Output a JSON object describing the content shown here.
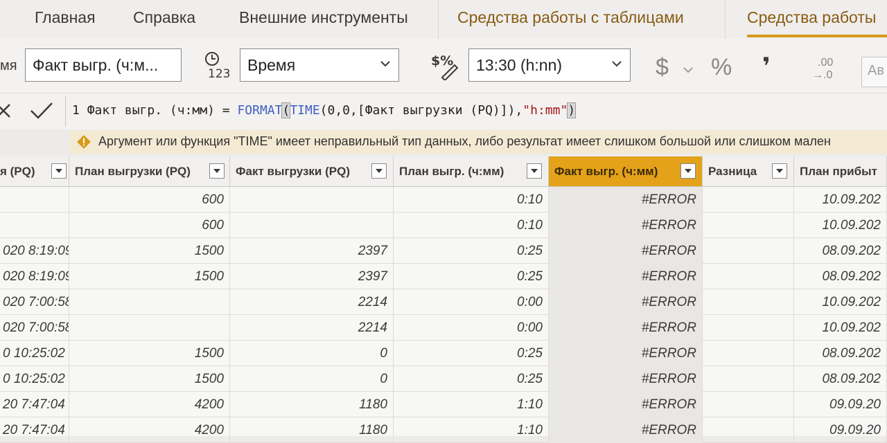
{
  "ribbon": {
    "tabs": [
      "Главная",
      "Справка",
      "Внешние инструменты",
      "Средства работы с таблицами",
      "Средства работы"
    ]
  },
  "toolbar": {
    "name_label": "мя",
    "name_value": "Факт выгр. (ч:м...",
    "data_type": "Время",
    "format": "13:30 (h:nn)",
    "currency_symbol": "$",
    "percent_symbol": "%",
    "comma_symbol": "❜",
    "decimals_top": ".00",
    "decimals_bottom": "→.0",
    "auto_label": "Ав"
  },
  "formula_bar": {
    "line_number": "1",
    "prefix": "Факт выгр. (ч:мм) = ",
    "fn_format": "FORMAT",
    "open_paren": "(",
    "fn_time": "TIME",
    "args": "(0,0,[Факт выгрузки (PQ)]),",
    "string_arg": "\"h:mm\"",
    "close_paren": ")"
  },
  "warning": {
    "text": "Аргумент или функция \"TIME\" имеет неправильный тип данных, либо результат имеет слишком большой или слишком мален"
  },
  "table": {
    "columns": [
      "я (PQ)",
      "План выгрузки (PQ)",
      "Факт выгрузки (PQ)",
      "План выгр. (ч:мм)",
      "Факт выгр. (ч:мм)",
      "Разница",
      "План прибыт"
    ],
    "rows": [
      [
        "",
        "600",
        "",
        "0:10",
        "#ERROR",
        "",
        "10.09.202"
      ],
      [
        "",
        "600",
        "",
        "0:10",
        "#ERROR",
        "",
        "10.09.202"
      ],
      [
        "020 8:19:09",
        "1500",
        "2397",
        "0:25",
        "#ERROR",
        "",
        "08.09.202"
      ],
      [
        "020 8:19:09",
        "1500",
        "2397",
        "0:25",
        "#ERROR",
        "",
        "08.09.202"
      ],
      [
        "020 7:00:58",
        "",
        "2214",
        "0:00",
        "#ERROR",
        "",
        "10.09.202"
      ],
      [
        "020 7:00:58",
        "",
        "2214",
        "0:00",
        "#ERROR",
        "",
        "10.09.202"
      ],
      [
        "0 10:25:02",
        "1500",
        "0",
        "0:25",
        "#ERROR",
        "",
        "08.09.202"
      ],
      [
        "0 10:25:02",
        "1500",
        "0",
        "0:25",
        "#ERROR",
        "",
        "08.09.202"
      ],
      [
        "20 7:47:04",
        "4200",
        "1180",
        "1:10",
        "#ERROR",
        "",
        "09.09.20"
      ],
      [
        "20 7:47:04",
        "4200",
        "1180",
        "1:10",
        "#ERROR",
        "",
        "09.09.20"
      ]
    ]
  },
  "colors": {
    "selected_column": "#e3a21a",
    "warning_background": "#f4ead4",
    "warning_icon": "#d69b1a",
    "context_tab": "#8a5a12"
  }
}
